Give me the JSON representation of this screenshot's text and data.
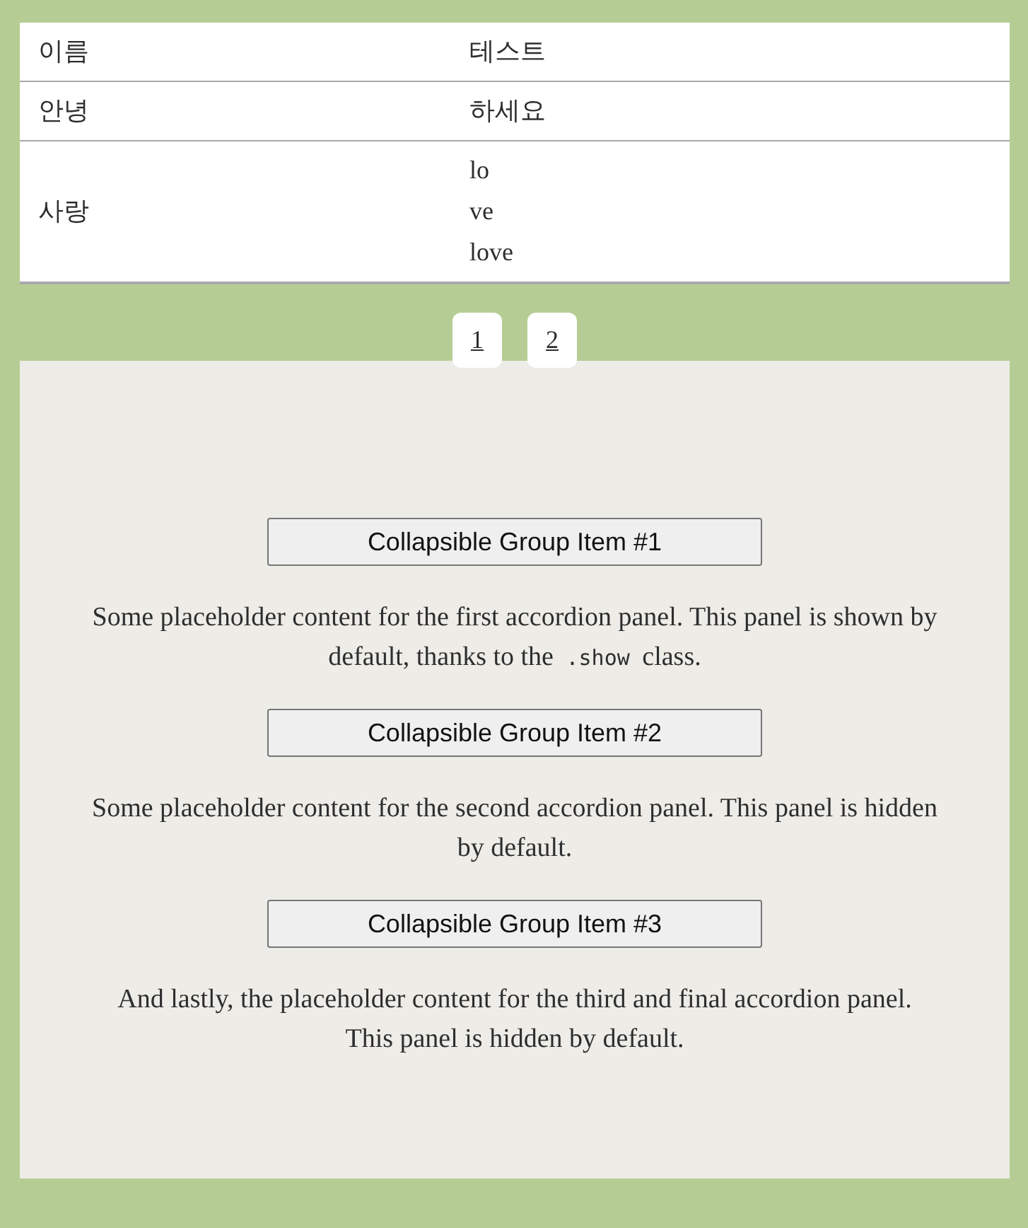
{
  "table": {
    "rows": [
      {
        "label": "이름",
        "value": "테스트"
      },
      {
        "label": "안녕",
        "value": "하세요"
      },
      {
        "label": "사랑",
        "value": "lo\nve\nlove"
      }
    ]
  },
  "pagination": {
    "pages": [
      "1",
      "2"
    ]
  },
  "accordion": {
    "items": [
      {
        "title": "Collapsible Group Item #1",
        "body": [
          {
            "kind": "text",
            "text": "Some placeholder content for the first accordion panel. This panel is shown by default, thanks to the "
          },
          {
            "kind": "code",
            "text": ".show"
          },
          {
            "kind": "text",
            "text": " class."
          }
        ]
      },
      {
        "title": "Collapsible Group Item #2",
        "body": [
          {
            "kind": "text",
            "text": "Some placeholder content for the second accordion panel. This panel is hidden by default."
          }
        ]
      },
      {
        "title": "Collapsible Group Item #3",
        "body": [
          {
            "kind": "text",
            "text": "And lastly, the placeholder content for the third and final accordion panel. This panel is hidden by default."
          }
        ]
      }
    ]
  }
}
